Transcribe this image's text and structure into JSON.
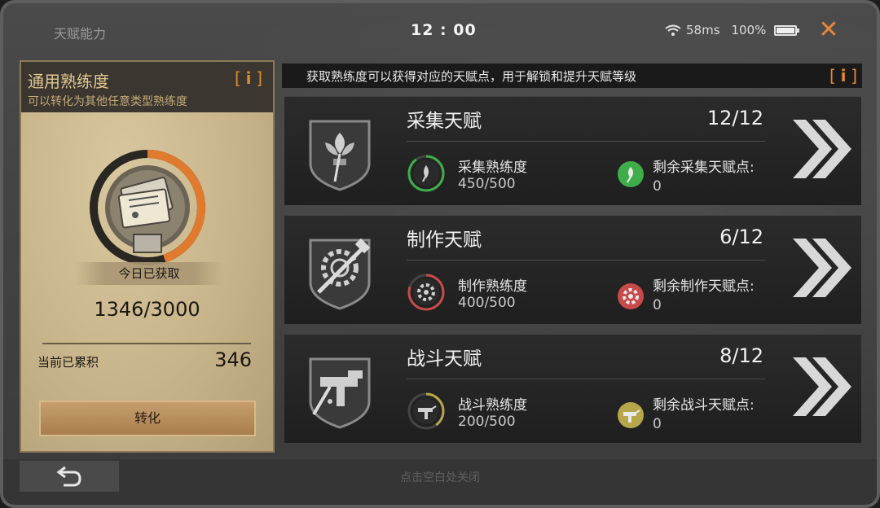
{
  "header": {
    "title": "天赋能力",
    "clock": "12 : 00",
    "ping": "58ms",
    "battery": "100%",
    "battery_level": 1.0,
    "close_icon": "close-icon"
  },
  "left_panel": {
    "title": "通用熟练度",
    "subtitle": "可以转化为其他任意类型熟练度",
    "info_label": "i",
    "today_label": "今日已获取",
    "today_value": "1346/3000",
    "today_progress": 0.4487,
    "accumulated_label": "当前已累积",
    "accumulated_value": "346",
    "convert_button": "转化"
  },
  "notice": {
    "text": "获取熟练度可以获得对应的天赋点，用于解锁和提升天赋等级",
    "info_label": "i"
  },
  "talents": [
    {
      "name": "采集天赋",
      "level": "12/12",
      "stat_label": "采集熟练度",
      "stat_value": "450/500",
      "stat_progress": 0.9,
      "remaining_label": "剩余采集天赋点:",
      "remaining_value": "0",
      "accent": "#3fae4a",
      "icon": "leaf-icon"
    },
    {
      "name": "制作天赋",
      "level": "6/12",
      "stat_label": "制作熟练度",
      "stat_value": "400/500",
      "stat_progress": 0.8,
      "remaining_label": "剩余制作天赋点:",
      "remaining_value": "0",
      "accent": "#c64a4a",
      "icon": "gear-icon"
    },
    {
      "name": "战斗天赋",
      "level": "8/12",
      "stat_label": "战斗熟练度",
      "stat_value": "200/500",
      "stat_progress": 0.4,
      "remaining_label": "剩余战斗天赋点:",
      "remaining_value": "0",
      "accent": "#b6a84a",
      "icon": "gun-icon"
    }
  ],
  "footer": {
    "hint": "点击空白处关闭",
    "back_icon": "back-icon"
  }
}
